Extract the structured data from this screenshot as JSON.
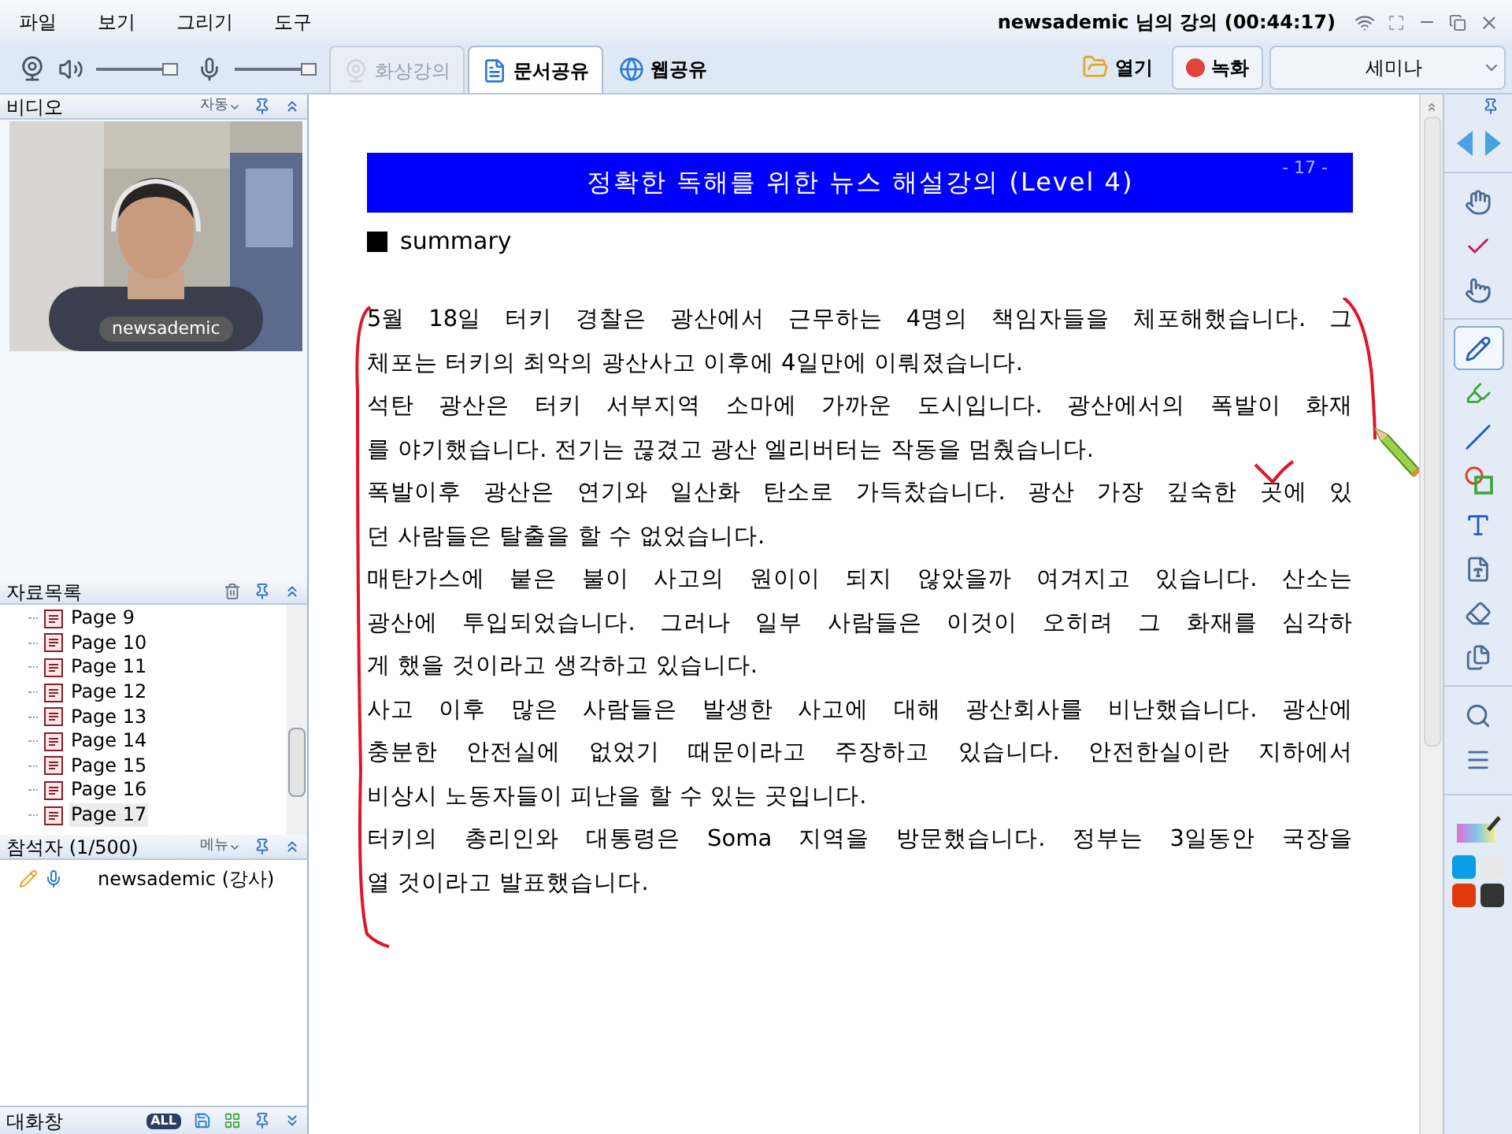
{
  "menu": [
    "파일",
    "보기",
    "그리기",
    "도구"
  ],
  "window": {
    "title": "newsademic 님의 강의 (00:44:17)"
  },
  "toolbar": {
    "speaker": {
      "level": 1
    },
    "mic": {
      "level": 1
    },
    "tabs": [
      {
        "label": "화상강의",
        "kind": "camera",
        "selected": false,
        "disabled": true
      },
      {
        "label": "문서공유",
        "kind": "document",
        "selected": true,
        "disabled": false
      },
      {
        "label": "웹공유",
        "kind": "web",
        "selected": false,
        "disabled": false
      }
    ],
    "open": "열기",
    "record": "녹화",
    "mode": "세미나"
  },
  "video_panel": {
    "title": "비디오",
    "mode": "자동",
    "name_tag": "newsademic"
  },
  "files_panel": {
    "title": "자료목록",
    "items": [
      {
        "label": "Page 9",
        "selected": false
      },
      {
        "label": "Page 10",
        "selected": false
      },
      {
        "label": "Page 11",
        "selected": false
      },
      {
        "label": "Page 12",
        "selected": false
      },
      {
        "label": "Page 13",
        "selected": false
      },
      {
        "label": "Page 14",
        "selected": false
      },
      {
        "label": "Page 15",
        "selected": false
      },
      {
        "label": "Page 16",
        "selected": false
      },
      {
        "label": "Page 17",
        "selected": true
      }
    ]
  },
  "participants_panel": {
    "title": "참석자 (1/500)",
    "menu": "메뉴",
    "items": [
      {
        "name": "newsademic (강사)"
      }
    ]
  },
  "chat_panel": {
    "title": "대화창",
    "filter": "ALL"
  },
  "document": {
    "heading": "정확한 독해를 위한 뉴스 해설강의 (Level 4)",
    "page_number": "- 17 -",
    "section": "summary",
    "paragraphs": [
      {
        "lines": [
          "5월 18일 터키 경찰은 광산에서 근무하는 4명의 책임자들을 체포해했습니다. 그",
          "체포는 터키의 최악의 광산사고 이후에 4일만에 이뤄졌습니다."
        ]
      },
      {
        "lines": [
          "석탄 광산은 터키 서부지역 소마에 가까운 도시입니다. 광산에서의 폭발이 화재",
          "를 야기했습니다. 전기는 끊겼고 광산 엘리버터는 작동을 멈췄습니다."
        ]
      },
      {
        "lines": [
          "폭발이후 광산은 연기와 일산화 탄소로 가득찼습니다. 광산 가장 깊숙한 곳에 있",
          "던 사람들은 탈출을 할 수 없었습니다."
        ]
      },
      {
        "lines": [
          "매탄가스에 붙은 불이 사고의 원이이 되지 않았을까 여겨지고 있습니다. 산소는",
          "광산에 투입되었습니다. 그러나 일부 사람들은 이것이 오히려 그 화재를 심각하",
          "게 했을 것이라고 생각하고 있습니다."
        ]
      },
      {
        "lines": [
          "사고 이후 많은 사람들은 발생한 사고에 대해 광산회사를 비난했습니다. 광산에",
          "충분한 안전실에 없었기 때문이라고 주장하고 있습니다. 안전한실이란 지하에서",
          "비상시 노동자들이 피난을 할 수 있는 곳입니다."
        ]
      },
      {
        "lines": [
          "터키의 총리인와 대통령은 Soma 지역을 방문했습니다. 정부는 3일동안 국장을",
          "열 것이라고 발표했습니다."
        ]
      }
    ]
  },
  "tools": [
    {
      "kind": "navigate",
      "selected": false
    },
    {
      "kind": "hand",
      "selected": false
    },
    {
      "kind": "check",
      "selected": false
    },
    {
      "kind": "pointer",
      "selected": false
    },
    {
      "kind": "pen",
      "selected": true
    },
    {
      "kind": "highlighter",
      "selected": false
    },
    {
      "kind": "line",
      "selected": false
    },
    {
      "kind": "shape",
      "selected": false
    },
    {
      "kind": "text",
      "selected": false
    },
    {
      "kind": "textbox",
      "selected": false
    },
    {
      "kind": "eraser",
      "selected": false
    },
    {
      "kind": "copy",
      "selected": false
    },
    {
      "kind": "zoom",
      "selected": false
    },
    {
      "kind": "linewidth",
      "selected": false
    }
  ],
  "colors": [
    {
      "color": "#0a9de6",
      "selected": false
    },
    {
      "color": "#e8e8e8",
      "selected": false
    },
    {
      "color": "#e03c0a",
      "selected": false
    },
    {
      "color": "#333333",
      "selected": false
    }
  ]
}
